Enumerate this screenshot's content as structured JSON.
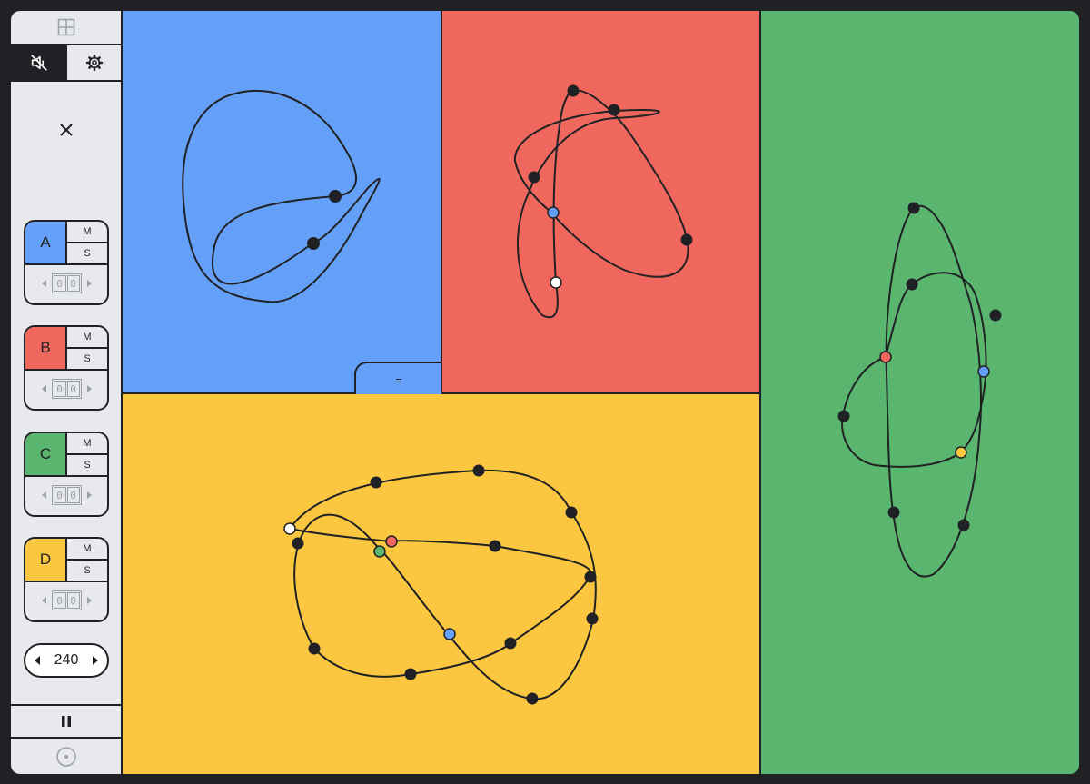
{
  "sidebar": {
    "tracks": [
      {
        "letter": "A",
        "color": "#64a0f7",
        "mute_label": "M",
        "solo_label": "S",
        "digits": [
          "0",
          "0"
        ]
      },
      {
        "letter": "B",
        "color": "#ef675d",
        "mute_label": "M",
        "solo_label": "S",
        "digits": [
          "0",
          "0"
        ]
      },
      {
        "letter": "C",
        "color": "#5ab66f",
        "mute_label": "M",
        "solo_label": "S",
        "digits": [
          "0",
          "0"
        ]
      },
      {
        "letter": "D",
        "color": "#fbc740",
        "mute_label": "M",
        "solo_label": "S",
        "digits": [
          "0",
          "0"
        ]
      }
    ],
    "tempo": "240",
    "icons": [
      "grid-layout-icon",
      "volume-off-icon",
      "gear-icon",
      "close-icon",
      "pause-icon",
      "record-icon"
    ]
  },
  "panes": {
    "A": {
      "color": "#64a0f7"
    },
    "B": {
      "color": "#ef675d"
    },
    "C": {
      "color": "#5ab66f"
    },
    "D": {
      "color": "#fbc740"
    }
  },
  "divider_handle": {
    "label": "="
  }
}
